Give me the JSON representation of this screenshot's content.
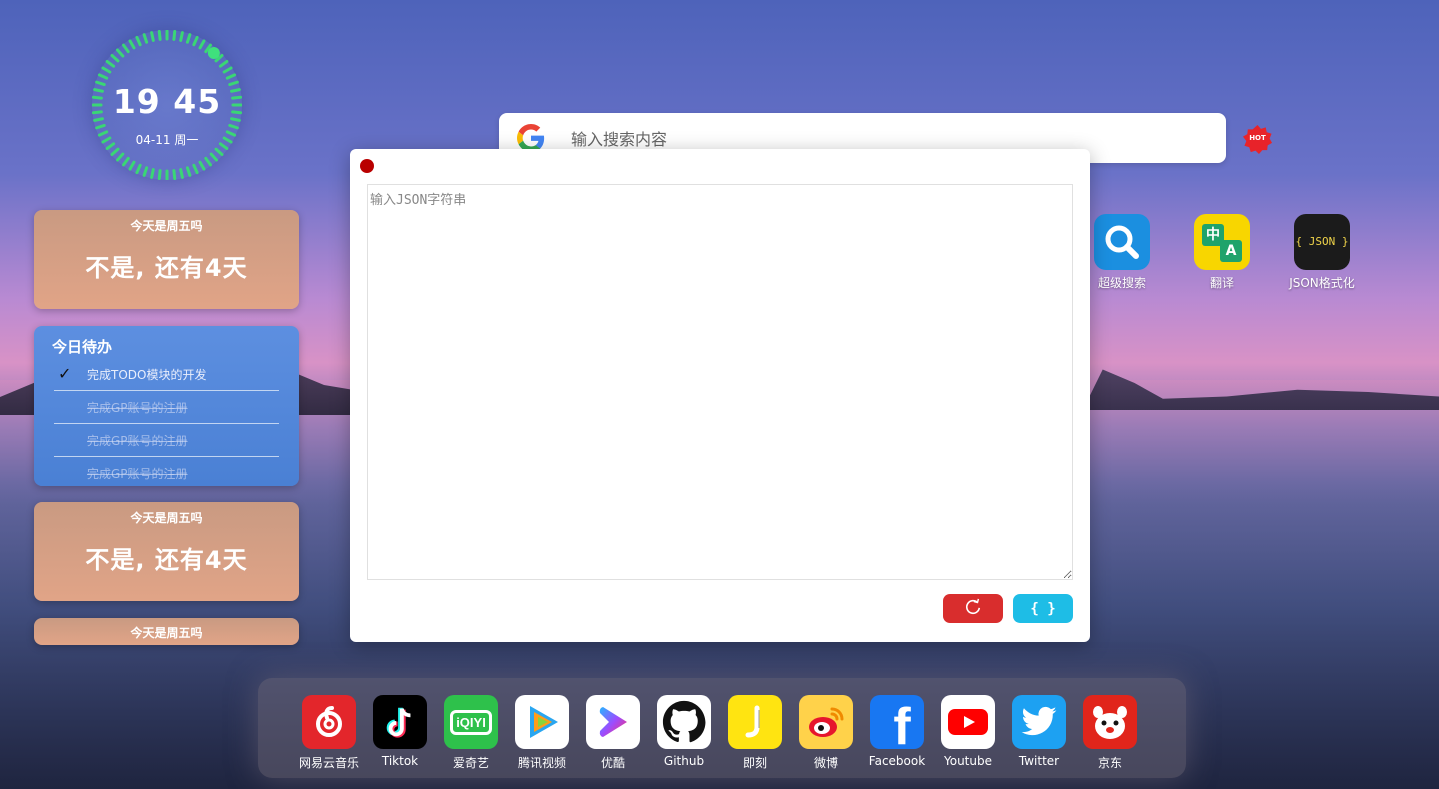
{
  "clock": {
    "time": "19 45",
    "date": "04-11 周一"
  },
  "cards": [
    {
      "title": "今天是周五吗",
      "text": "不是, 还有4天"
    },
    {
      "title": "今天是周五吗",
      "text": "不是, 还有4天"
    },
    {
      "title": "今天是周五吗"
    }
  ],
  "todo": {
    "title": "今日待办",
    "items": [
      {
        "text": "完成TODO模块的开发",
        "done": false,
        "checked": true
      },
      {
        "text": "完成GP账号的注册",
        "done": true
      },
      {
        "text": "完成GP账号的注册",
        "done": true
      },
      {
        "text": "完成GP账号的注册",
        "done": true
      }
    ]
  },
  "search": {
    "placeholder": "输入搜索内容",
    "engine_icon": "google-logo",
    "badge": "HOT"
  },
  "tools": [
    {
      "label": "超级搜索",
      "icon": "search-icon"
    },
    {
      "label": "翻译",
      "icon": "translate-icon",
      "glyph_a": "中",
      "glyph_b": "A"
    },
    {
      "label": "JSON格式化",
      "icon": "json-icon",
      "glyph": "{ JSON }"
    }
  ],
  "json_modal": {
    "placeholder": "输入JSON字符串",
    "reset_icon": "refresh-icon",
    "format_label": "{ }"
  },
  "dock": [
    {
      "label": "网易云音乐",
      "icon": "netease-music-icon",
      "color": "#e3262b"
    },
    {
      "label": "Tiktok",
      "icon": "tiktok-icon",
      "color": "#000000"
    },
    {
      "label": "爱奇艺",
      "icon": "iqiyi-icon",
      "color": "#2ec14b",
      "glyph": "iQIYI"
    },
    {
      "label": "腾讯视频",
      "icon": "tencent-video-icon",
      "color": "#ffffff"
    },
    {
      "label": "优酷",
      "icon": "youku-icon",
      "color": "#ffffff"
    },
    {
      "label": "Github",
      "icon": "github-icon",
      "color": "#ffffff"
    },
    {
      "label": "即刻",
      "icon": "jike-icon",
      "color": "#ffe411"
    },
    {
      "label": "微博",
      "icon": "weibo-icon",
      "color": "#ffd24a"
    },
    {
      "label": "Facebook",
      "icon": "facebook-icon",
      "color": "#1877f2",
      "glyph": "f"
    },
    {
      "label": "Youtube",
      "icon": "youtube-icon",
      "color": "#ffffff"
    },
    {
      "label": "Twitter",
      "icon": "twitter-icon",
      "color": "#1da1f2"
    },
    {
      "label": "京东",
      "icon": "jd-icon",
      "color": "#e1251b"
    }
  ]
}
